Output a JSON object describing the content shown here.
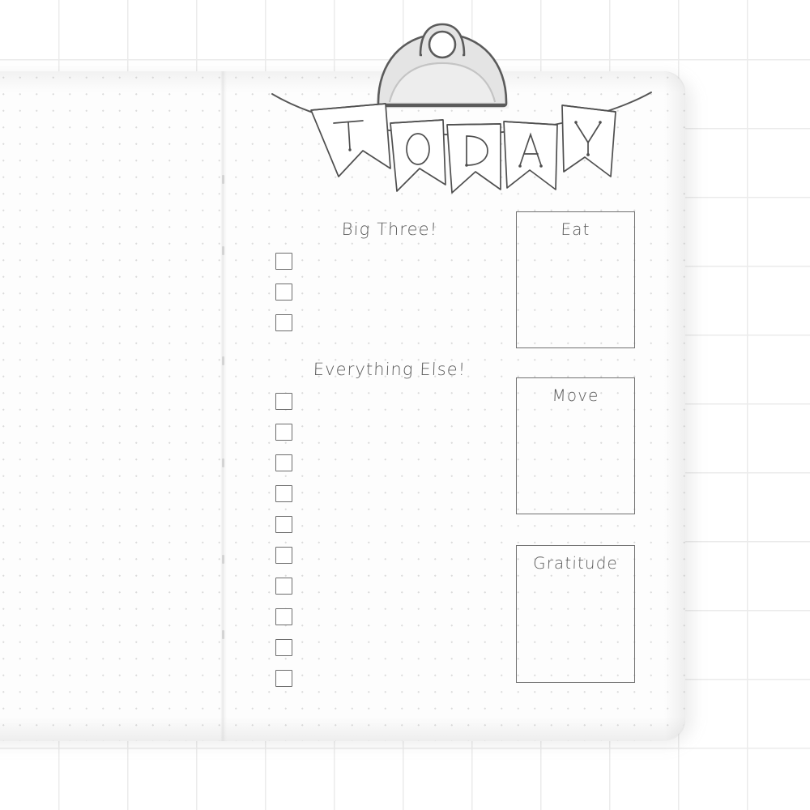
{
  "page": {
    "kind": "bullet-journal-daily-spread",
    "title_banner": {
      "name": "today-banner",
      "letters": [
        "T",
        "O",
        "D",
        "A",
        "Y"
      ],
      "word": "TODAY"
    },
    "clip": {
      "name": "clipboard-clip",
      "fill": "#e2e2e2",
      "stroke": "#5b5b5b",
      "hole_fill": "#ffffff"
    },
    "colors": {
      "background": "#ffffff",
      "background_grid_line": "#ebebeb",
      "page": "#fdfdfd",
      "dot_grid": "#cfcfcf",
      "ink": "#5a5a5a",
      "box_stroke": "#707070",
      "checkbox_stroke": "#6d6d6d"
    }
  },
  "sections": {
    "big_three": {
      "label": "Big Three!",
      "checkbox_count": 3,
      "checkboxes": [
        {
          "label": ""
        },
        {
          "label": ""
        },
        {
          "label": ""
        }
      ]
    },
    "everything_else": {
      "label": "Everything Else!",
      "checkbox_count": 10,
      "checkboxes": [
        {
          "label": ""
        },
        {
          "label": ""
        },
        {
          "label": ""
        },
        {
          "label": ""
        },
        {
          "label": ""
        },
        {
          "label": ""
        },
        {
          "label": ""
        },
        {
          "label": ""
        },
        {
          "label": ""
        },
        {
          "label": ""
        }
      ]
    }
  },
  "panels": [
    {
      "id": "eat",
      "title": "Eat",
      "content": ""
    },
    {
      "id": "move",
      "title": "Move",
      "content": ""
    },
    {
      "id": "gratitude",
      "title": "Gratitude",
      "content": ""
    }
  ]
}
